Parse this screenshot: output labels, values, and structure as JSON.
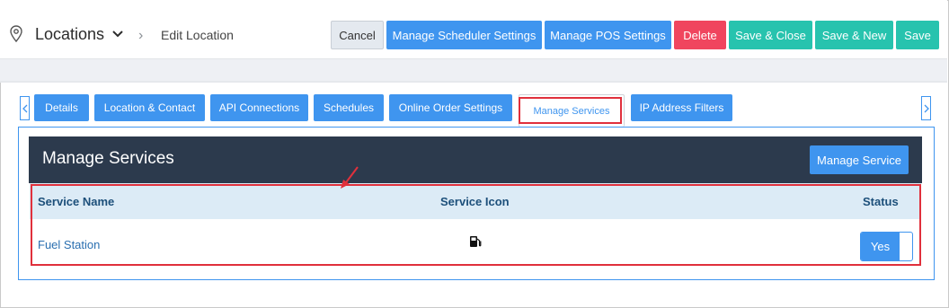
{
  "header": {
    "section": "Locations",
    "breadcrumb_current": "Edit Location",
    "buttons": {
      "cancel": "Cancel",
      "scheduler": "Manage Scheduler Settings",
      "pos": "Manage POS Settings",
      "delete": "Delete",
      "save_close": "Save & Close",
      "save_new": "Save & New",
      "save": "Save"
    }
  },
  "tabs": [
    {
      "label": "Details"
    },
    {
      "label": "Location & Contact"
    },
    {
      "label": "API Connections"
    },
    {
      "label": "Schedules"
    },
    {
      "label": "Online Order Settings"
    },
    {
      "label": "Manage Services",
      "active": true
    },
    {
      "label": "IP Address Filters"
    }
  ],
  "card": {
    "title": "Manage Services",
    "manage_button": "Manage Service",
    "columns": {
      "name": "Service Name",
      "icon": "Service Icon",
      "status": "Status"
    },
    "rows": [
      {
        "name": "Fuel Station",
        "icon": "fuel-pump-icon",
        "status": "Yes"
      }
    ]
  },
  "colors": {
    "primary": "#3f95ef",
    "danger": "#f0455e",
    "success": "#27c3ae",
    "card_header": "#2c3a4d",
    "annotation": "#e0303c"
  }
}
